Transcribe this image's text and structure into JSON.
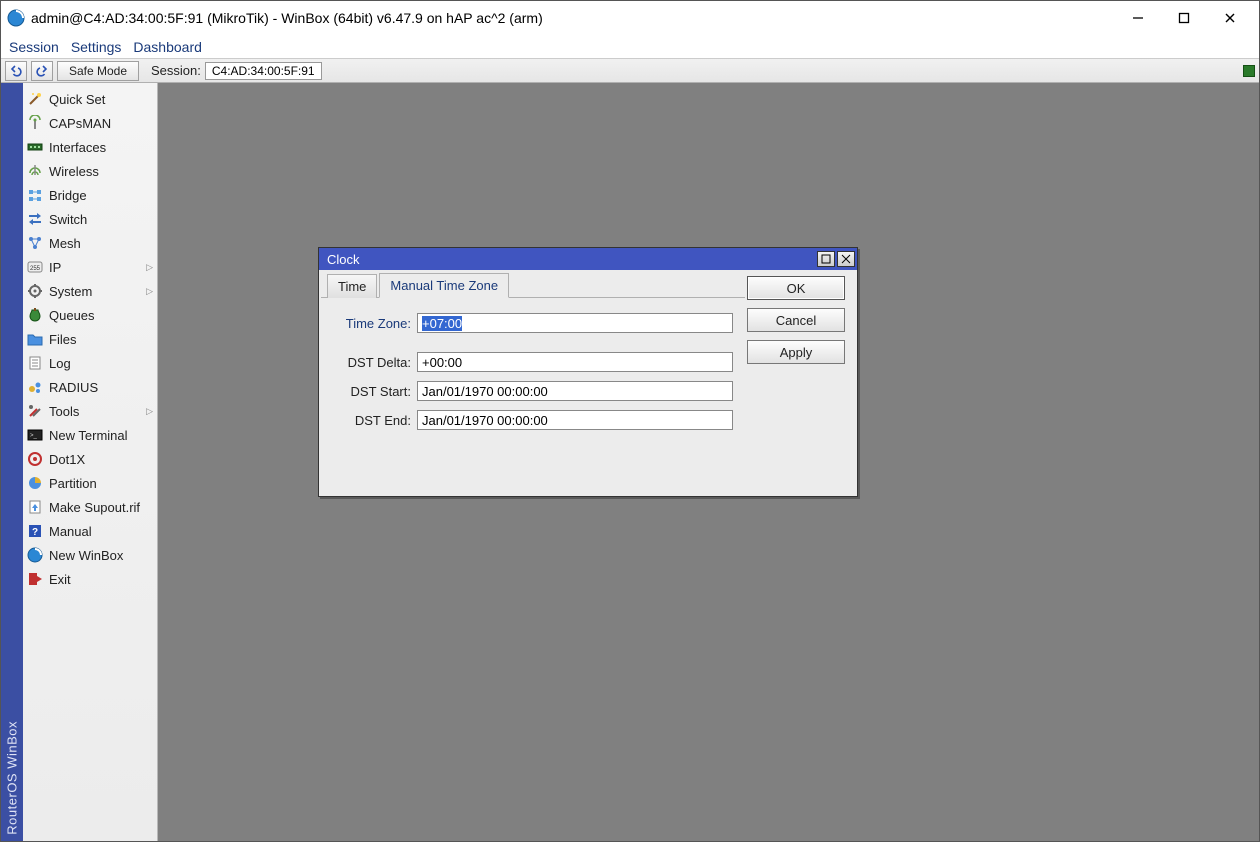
{
  "window": {
    "title": "admin@C4:AD:34:00:5F:91 (MikroTik) - WinBox (64bit) v6.47.9 on hAP ac^2 (arm)"
  },
  "menubar": {
    "items": [
      "Session",
      "Settings",
      "Dashboard"
    ]
  },
  "toolbar": {
    "undo_icon": "undo",
    "redo_icon": "redo",
    "safe_mode_label": "Safe Mode",
    "session_label": "Session:",
    "session_value": "C4:AD:34:00:5F:91"
  },
  "sidebar_brand": "RouterOS  WinBox",
  "sidebar": {
    "items": [
      {
        "label": "Quick Set",
        "icon": "wand"
      },
      {
        "label": "CAPsMAN",
        "icon": "antenna"
      },
      {
        "label": "Interfaces",
        "icon": "interfaces"
      },
      {
        "label": "Wireless",
        "icon": "wireless"
      },
      {
        "label": "Bridge",
        "icon": "bridge"
      },
      {
        "label": "Switch",
        "icon": "switch"
      },
      {
        "label": "Mesh",
        "icon": "mesh"
      },
      {
        "label": "IP",
        "icon": "ip",
        "expand": true
      },
      {
        "label": "System",
        "icon": "system",
        "expand": true
      },
      {
        "label": "Queues",
        "icon": "queues"
      },
      {
        "label": "Files",
        "icon": "files"
      },
      {
        "label": "Log",
        "icon": "log"
      },
      {
        "label": "RADIUS",
        "icon": "radius"
      },
      {
        "label": "Tools",
        "icon": "tools",
        "expand": true
      },
      {
        "label": "New Terminal",
        "icon": "terminal"
      },
      {
        "label": "Dot1X",
        "icon": "dot1x"
      },
      {
        "label": "Partition",
        "icon": "partition"
      },
      {
        "label": "Make Supout.rif",
        "icon": "supout"
      },
      {
        "label": "Manual",
        "icon": "manual"
      },
      {
        "label": "New WinBox",
        "icon": "winbox"
      },
      {
        "label": "Exit",
        "icon": "exit"
      }
    ]
  },
  "dialog": {
    "title": "Clock",
    "tabs": {
      "time": "Time",
      "manual": "Manual Time Zone"
    },
    "fields": {
      "time_zone_label": "Time Zone:",
      "time_zone_value": "+07:00",
      "dst_delta_label": "DST Delta:",
      "dst_delta_value": "+00:00",
      "dst_start_label": "DST Start:",
      "dst_start_value": "Jan/01/1970 00:00:00",
      "dst_end_label": "DST End:",
      "dst_end_value": "Jan/01/1970 00:00:00"
    },
    "buttons": {
      "ok": "OK",
      "cancel": "Cancel",
      "apply": "Apply"
    }
  }
}
